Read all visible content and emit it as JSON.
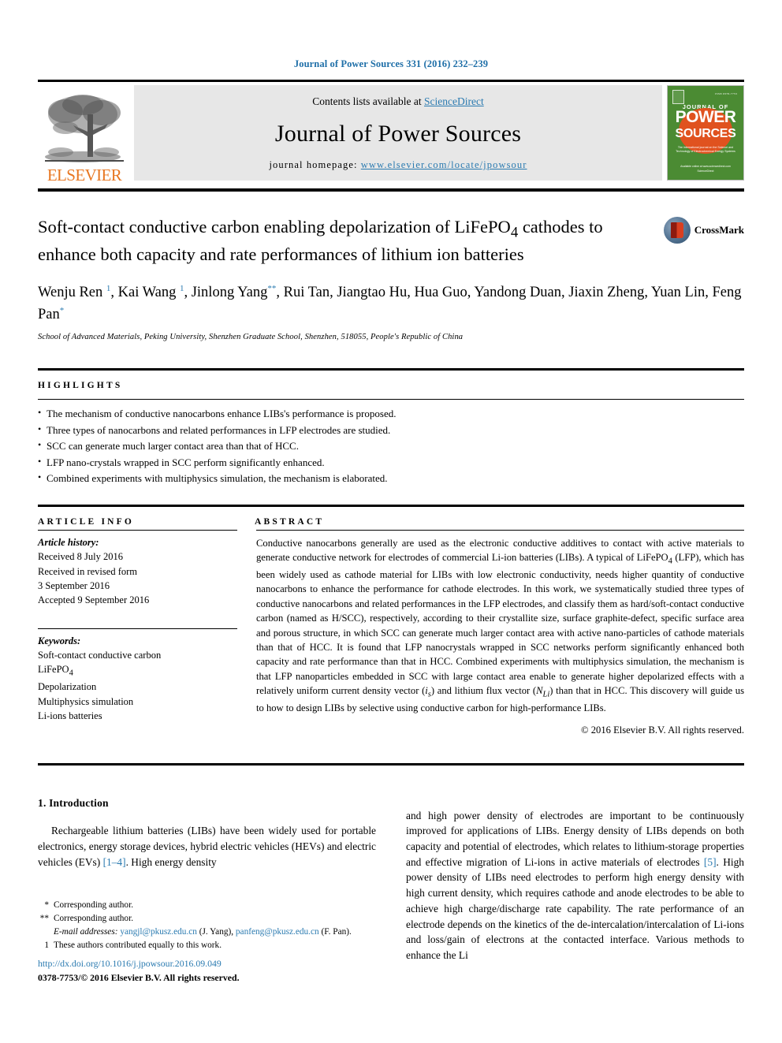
{
  "running_head": "Journal of Power Sources 331 (2016) 232–239",
  "masthead": {
    "elsevier_wordmark": "ELSEVIER",
    "contents_prefix": "Contents lists available at ",
    "contents_link": "ScienceDirect",
    "journal_title": "Journal of Power Sources",
    "homepage_prefix": "journal homepage: ",
    "homepage_url": "www.elsevier.com/locate/jpowsour",
    "cover": {
      "journal_of": "JOURNAL OF",
      "power": "POWER",
      "sources": "SOURCES",
      "subtitle": "The international journal on the Science and Technology of Electrochemical Energy Systems",
      "footer": "Available online at www.sciencedirect.com ScienceDirect"
    }
  },
  "article": {
    "title": "Soft-contact conductive carbon enabling depolarization of LiFePO4 cathodes to enhance both capacity and rate performances of lithium ion batteries",
    "title_html": "Soft-contact conductive carbon enabling depolarization of LiFePO<sub>4</sub> cathodes to enhance both capacity and rate performances of lithium ion batteries",
    "crossmark_label": "CrossMark",
    "authors_html": "Wenju Ren <sup>1</sup>, Kai Wang <sup>1</sup>, Jinlong Yang<sup>**</sup>, Rui Tan, Jiangtao Hu, Hua Guo, Yandong Duan, Jiaxin Zheng, Yuan Lin, Feng Pan<sup>*</sup>",
    "affiliation": "School of Advanced Materials, Peking University, Shenzhen Graduate School, Shenzhen, 518055, People's Republic of China"
  },
  "highlights": {
    "heading": "HIGHLIGHTS",
    "items": [
      "The mechanism of conductive nanocarbons enhance LIBs's performance is proposed.",
      "Three types of nanocarbons and related performances in LFP electrodes are studied.",
      "SCC can generate much larger contact area than that of HCC.",
      "LFP nano-crystals wrapped in SCC perform significantly enhanced.",
      "Combined experiments with multiphysics simulation, the mechanism is elaborated."
    ]
  },
  "article_info": {
    "heading": "ARTICLE INFO",
    "history_label": "Article history:",
    "history": [
      "Received 8 July 2016",
      "Received in revised form",
      "3 September 2016",
      "Accepted 9 September 2016"
    ],
    "keywords_label": "Keywords:",
    "keywords": [
      "Soft-contact conductive carbon",
      "LiFePO4",
      "Depolarization",
      "Multiphysics simulation",
      "Li-ions batteries"
    ]
  },
  "abstract": {
    "heading": "ABSTRACT",
    "text_html": "Conductive nanocarbons generally are used as the electronic conductive additives to contact with active materials to generate conductive network for electrodes of commercial Li-ion batteries (LIBs). A typical of LiFePO<sub>4</sub> (LFP), which has been widely used as cathode material for LIBs with low electronic conductivity, needs higher quantity of conductive nanocarbons to enhance the performance for cathode electrodes. In this work, we systematically studied three types of conductive nanocarbons and related performances in the LFP electrodes, and classify them as hard/soft-contact conductive carbon (named as H/SCC), respectively, according to their crystallite size, surface graphite-defect, specific surface area and porous structure, in which SCC can generate much larger contact area with active nano-particles of cathode materials than that of HCC. It is found that LFP nanocrystals wrapped in SCC networks perform significantly enhanced both capacity and rate performance than that in HCC. Combined experiments with multiphysics simulation, the mechanism is that LFP nanoparticles embedded in SCC with large contact area enable to generate higher depolarized effects with a relatively uniform current density vector (<i>i<sub>s</sub></i>) and lithium flux vector (<i>N<sub>Li</sub></i>) than that in HCC. This discovery will guide us to how to design LIBs by selective using conductive carbon for high-performance LIBs.",
    "copyright": "© 2016 Elsevier B.V. All rights reserved."
  },
  "body": {
    "section_number_title": "1. Introduction",
    "left_paragraph_html": "Rechargeable lithium batteries (LIBs) have been widely used for portable electronics, energy storage devices, hybrid electric vehicles (HEVs) and electric vehicles (EVs) <span class=\"ref\">[1–4]</span>. High energy density",
    "right_paragraph_html": "and high power density of electrodes are important to be continuously improved for applications of LIBs. Energy density of LIBs depends on both capacity and potential of electrodes, which relates to lithium-storage properties and effective migration of Li-ions in active materials of electrodes <span class=\"ref\">[5]</span>. High power density of LIBs need electrodes to perform high energy density with high current density, which requires cathode and anode electrodes to be able to achieve high charge/discharge rate capability. The rate performance of an electrode depends on the kinetics of the de-intercalation/intercalation of Li-ions and loss/gain of electrons at the contacted interface. Various methods to enhance the Li"
  },
  "footnotes": {
    "items": [
      {
        "mark": "*",
        "text_html": "Corresponding author."
      },
      {
        "mark": "**",
        "text_html": "Corresponding author."
      },
      {
        "mark": "",
        "text_html": "<span class=\"em\">E-mail addresses:</span> <span class=\"link\">yangjl@pkusz.edu.cn</span> (J. Yang), <span class=\"link\">panfeng@pkusz.edu.cn</span> (F. Pan)."
      },
      {
        "mark": "1",
        "text_html": "These authors contributed equally to this work."
      }
    ]
  },
  "doi_block": {
    "doi": "http://dx.doi.org/10.1016/j.jpowsour.2016.09.049",
    "issn_line": "0378-7753/© 2016 Elsevier B.V. All rights reserved."
  },
  "colors": {
    "link_blue": "#2a7ab0",
    "elsevier_orange": "#E87722",
    "cover_green": "#4b8b33",
    "cover_orange": "#e0521f",
    "banner_gray": "#e7e7e7"
  }
}
